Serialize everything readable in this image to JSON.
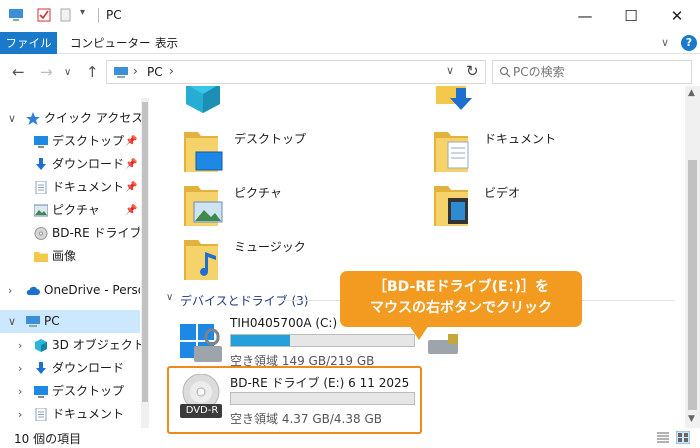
{
  "window": {
    "title": "PC"
  },
  "ribbon": {
    "tabs": [
      "ファイル",
      "コンピューター",
      "表示"
    ]
  },
  "address": {
    "path": "PC"
  },
  "search": {
    "placeholder": "PCの検索"
  },
  "nav": {
    "items": [
      {
        "label": "クイック アクセス"
      },
      {
        "label": "デスクトップ"
      },
      {
        "label": "ダウンロード"
      },
      {
        "label": "ドキュメント"
      },
      {
        "label": "ピクチャ"
      },
      {
        "label": "BD-RE ドライブ (E:"
      },
      {
        "label": "画像"
      },
      {
        "label": "OneDrive - Person"
      },
      {
        "label": "PC"
      },
      {
        "label": "3D オブジェクト"
      },
      {
        "label": "ダウンロード"
      },
      {
        "label": "デスクトップ"
      },
      {
        "label": "ドキュメント"
      }
    ]
  },
  "folders": {
    "desktop": "デスクトップ",
    "documents": "ドキュメント",
    "pictures": "ピクチャ",
    "videos": "ビデオ",
    "music": "ミュージック"
  },
  "devices": {
    "header": "デバイスとドライブ (3)",
    "drive_c": {
      "name": "TIH0405700A (C:)",
      "free": "空き領域 149 GB/219 GB",
      "used_fraction": 0.32
    },
    "drive_e": {
      "name": "BD-RE ドライブ (E:) 6 11 2025",
      "free": "空き領域 4.37 GB/4.38 GB",
      "used_fraction": 0.0,
      "disc_label": "DVD-R"
    }
  },
  "callout": {
    "line1": "［BD-REドライブ(E：)］を",
    "line2": "マウスの右ボタンでクリック"
  },
  "status": {
    "count": "10 個の項目"
  },
  "colors": {
    "accent": "#1979ca",
    "callout": "#f39a20",
    "highlight": "#f08a1c",
    "progress": "#26a0da"
  }
}
